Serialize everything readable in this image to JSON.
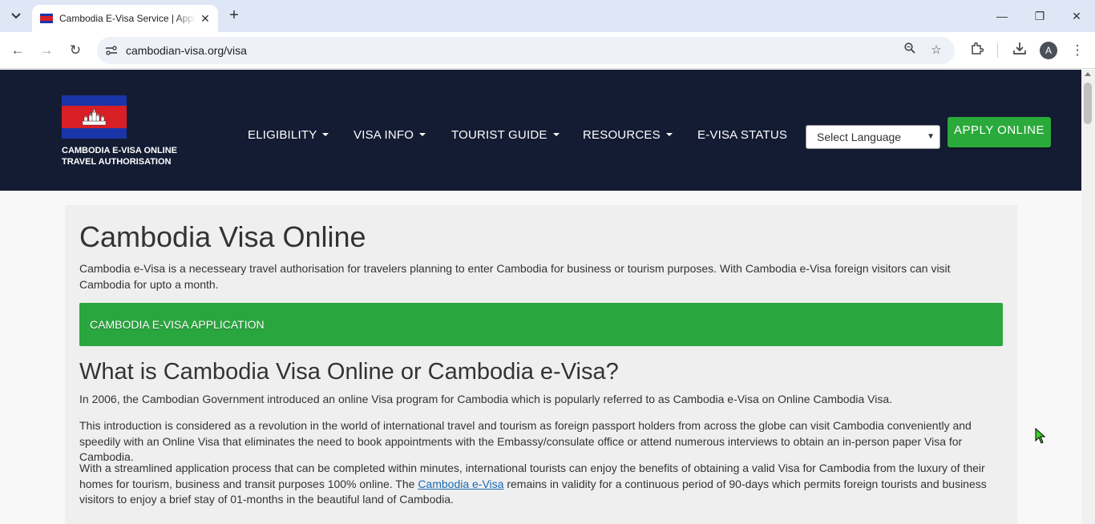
{
  "browser": {
    "tab_title": "Cambodia E-Visa Service | Appl",
    "url": "cambodian-visa.org/visa",
    "profile_initial": "A"
  },
  "header": {
    "brand_line1": "CAMBODIA E-VISA ONLINE",
    "brand_line2": "TRAVEL AUTHORISATION",
    "nav": {
      "eligibility": "ELIGIBILITY",
      "visa_info": "VISA INFO",
      "tourist_guide": "TOURIST GUIDE",
      "resources": "RESOURCES",
      "evisa_status": "E-VISA STATUS"
    },
    "language_select": "Select Language",
    "apply_button": "APPLY ONLINE"
  },
  "main": {
    "title": "Cambodia Visa Online",
    "intro": "Cambodia e-Visa is a necesseary travel authorisation for travelers planning to enter Cambodia for business or tourism purposes. With Cambodia e-Visa foreign visitors can visit Cambodia for upto a month.",
    "application_bar": "CAMBODIA E-VISA APPLICATION",
    "section_title": "What is Cambodia Visa Online or Cambodia e-Visa?",
    "para1": "In 2006, the Cambodian Government introduced an online Visa program for Cambodia which is popularly referred to as Cambodia e-Visa on Online Cambodia Visa.",
    "para2": "This introduction is considered as a revolution in the world of international travel and tourism as foreign passport holders from across the globe can visit Cambodia conveniently and speedily with an Online Visa that eliminates the need to book appointments with the Embassy/consulate office or attend numerous interviews to obtain an in-person paper Visa for Cambodia.",
    "para3_before": "With a streamlined application process that can be completed within minutes, international tourists can enjoy the benefits of obtaining a valid Visa for Cambodia from the luxury of their homes for tourism, business and transit purposes 100% online. The ",
    "para3_link": "Cambodia e-Visa",
    "para3_after": " remains in validity for a continuous period of 90-days which permits foreign tourists and business visitors to enjoy a brief stay of 01-months in the beautiful land of Cambodia."
  },
  "colors": {
    "header_bg": "#141c33",
    "accent_green": "#2aa63f",
    "flag_blue": "#1a35a8",
    "flag_red": "#d81f26",
    "link": "#1a6bb5"
  }
}
